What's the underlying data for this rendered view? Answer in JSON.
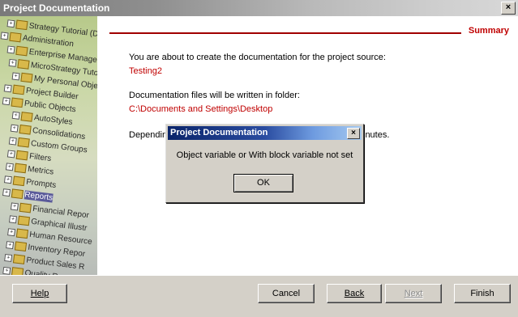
{
  "window": {
    "title": "Project Documentation",
    "close_label": "×"
  },
  "sidebar": {
    "tree": [
      {
        "label": "Strategy Tutorial (Dev",
        "kind": "project"
      },
      {
        "label": "Administration",
        "kind": "project"
      },
      {
        "label": "Enterprise Manager Demo",
        "kind": "project"
      },
      {
        "label": "MicroStrategy Tutorial",
        "kind": "project"
      },
      {
        "label": "My Personal Objects",
        "kind": "folder"
      },
      {
        "label": "Project Builder",
        "kind": "folder"
      },
      {
        "label": "Public Objects",
        "kind": "folder"
      },
      {
        "label": "AutoStyles",
        "kind": "folder"
      },
      {
        "label": "Consolidations",
        "kind": "folder"
      },
      {
        "label": "Custom Groups",
        "kind": "folder"
      },
      {
        "label": "Filters",
        "kind": "folder"
      },
      {
        "label": "Metrics",
        "kind": "folder"
      },
      {
        "label": "Prompts",
        "kind": "folder"
      },
      {
        "label": "Reports",
        "kind": "folder",
        "selected": true
      },
      {
        "label": "Financial Repor",
        "kind": "folder"
      },
      {
        "label": "Graphical Illustr",
        "kind": "folder"
      },
      {
        "label": "Human Resource",
        "kind": "folder"
      },
      {
        "label": "Inventory Repor",
        "kind": "folder"
      },
      {
        "label": "Product Sales R",
        "kind": "folder"
      },
      {
        "label": "Quality Report",
        "kind": "folder"
      }
    ]
  },
  "main": {
    "section_title": "Summary",
    "intro_text": "You are about to create the documentation for the project source:",
    "project_source": "Testing2",
    "folder_text": "Documentation files will be written in folder:",
    "folder_path": "C:\\Documents and Settings\\Desktop",
    "partial_text_left": "Dependin",
    "partial_text_right": "inutes."
  },
  "footer": {
    "help": "Help",
    "cancel": "Cancel",
    "back": "Back",
    "next": "Next",
    "finish": "Finish"
  },
  "dialog": {
    "title": "Project Documentation",
    "close_label": "×",
    "message": "Object variable or With block variable not set",
    "ok": "OK"
  }
}
